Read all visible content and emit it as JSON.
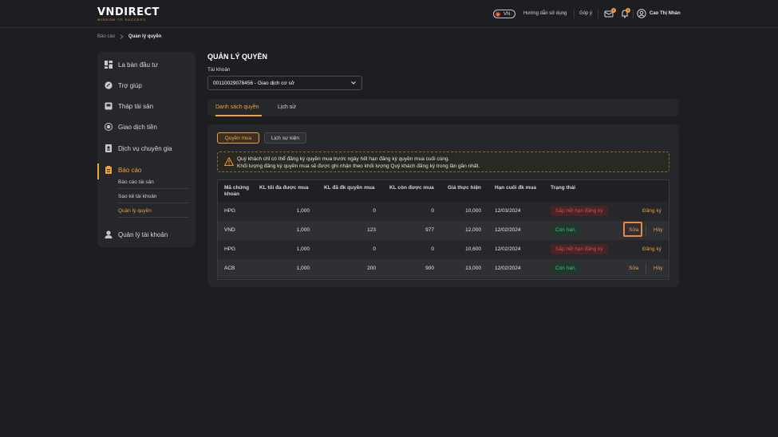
{
  "header": {
    "logo_text": "VNDIRECT",
    "logo_tagline": "WISDOM TO SUCCESS",
    "lang": "VN",
    "guide_label": "Hướng dẫn sử dụng",
    "feedback_label": "Góp ý",
    "cart_badge": "0",
    "notif_badge": "3",
    "username": "Cao Thị Nhàn"
  },
  "breadcrumb": {
    "root": "Báo cáo",
    "current": "Quản lý quyền"
  },
  "sidebar": {
    "items": [
      {
        "label": "La bàn đầu tư",
        "icon": "dashboard-icon"
      },
      {
        "label": "Trợ giúp",
        "icon": "help-chat-icon"
      },
      {
        "label": "Tháp tài sản",
        "icon": "asset-tower-icon"
      },
      {
        "label": "Giao dịch tiền",
        "icon": "money-transfer-icon"
      },
      {
        "label": "Dịch vụ chuyên gia",
        "icon": "expert-service-icon"
      },
      {
        "label": "Báo cáo",
        "icon": "report-icon"
      },
      {
        "label": "Quản lý tài khoản",
        "icon": "user-icon"
      }
    ],
    "report_sub": [
      "Báo cáo tài sản",
      "Sao kê tài khoản",
      "Quản lý quyền"
    ]
  },
  "page": {
    "title": "QUẢN LÝ QUYỀN",
    "account_label": "Tài khoản",
    "account_value": "00110029078456 - Giao dịch cơ sở",
    "tabs": [
      "Danh sách quyền",
      "Lịch sử"
    ],
    "pills": [
      "Quyền mua",
      "Lịch sự kiện"
    ],
    "notice_line1": "Quý khách chỉ có thể đăng ký quyền mua trước ngày hết hạn đăng ký quyền mua cuối cùng.",
    "notice_line2": "Khối lượng đăng ký quyền mua sẽ được ghi nhận theo khối lượng Quý khách đăng ký trong lần gần nhất."
  },
  "table": {
    "headers": {
      "code_1": "Mã chứng",
      "code_2": "khoản",
      "max": "KL tối đa được mua",
      "registered": "KL đã đk quyền mua",
      "remaining": "KL còn được mua",
      "price": "Giá thực hiện",
      "deadline": "Hạn cuối đk mua",
      "status": "Trạng thái"
    },
    "rows": [
      {
        "code": "HPG",
        "max": "1,000",
        "registered": "0",
        "remaining": "0",
        "price": "10,000",
        "deadline": "12/03/2024",
        "status": "Sắp hết hạn đăng ký",
        "status_type": "exp",
        "action1": "Đăng ký",
        "action2": ""
      },
      {
        "code": "VND",
        "max": "1,000",
        "registered": "123",
        "remaining": "977",
        "price": "12,000",
        "deadline": "12/02/2024",
        "status": "Còn hạn",
        "status_type": "ok",
        "action1": "Sửa",
        "action2": "Hủy"
      },
      {
        "code": "HPG",
        "max": "1,000",
        "registered": "0",
        "remaining": "0",
        "price": "10,600",
        "deadline": "12/02/2024",
        "status": "Sắp hết hạn đăng ký",
        "status_type": "exp",
        "action1": "Đăng ký",
        "action2": ""
      },
      {
        "code": "ACB",
        "max": "1,000",
        "registered": "200",
        "remaining": "900",
        "price": "13,000",
        "deadline": "12/02/2024",
        "status": "Còn hạn",
        "status_type": "ok",
        "action1": "Sửa",
        "action2": "Hủy"
      }
    ]
  },
  "colors": {
    "accent": "#f0a03c",
    "expired": "#c0555a",
    "valid": "#3fbf72"
  }
}
